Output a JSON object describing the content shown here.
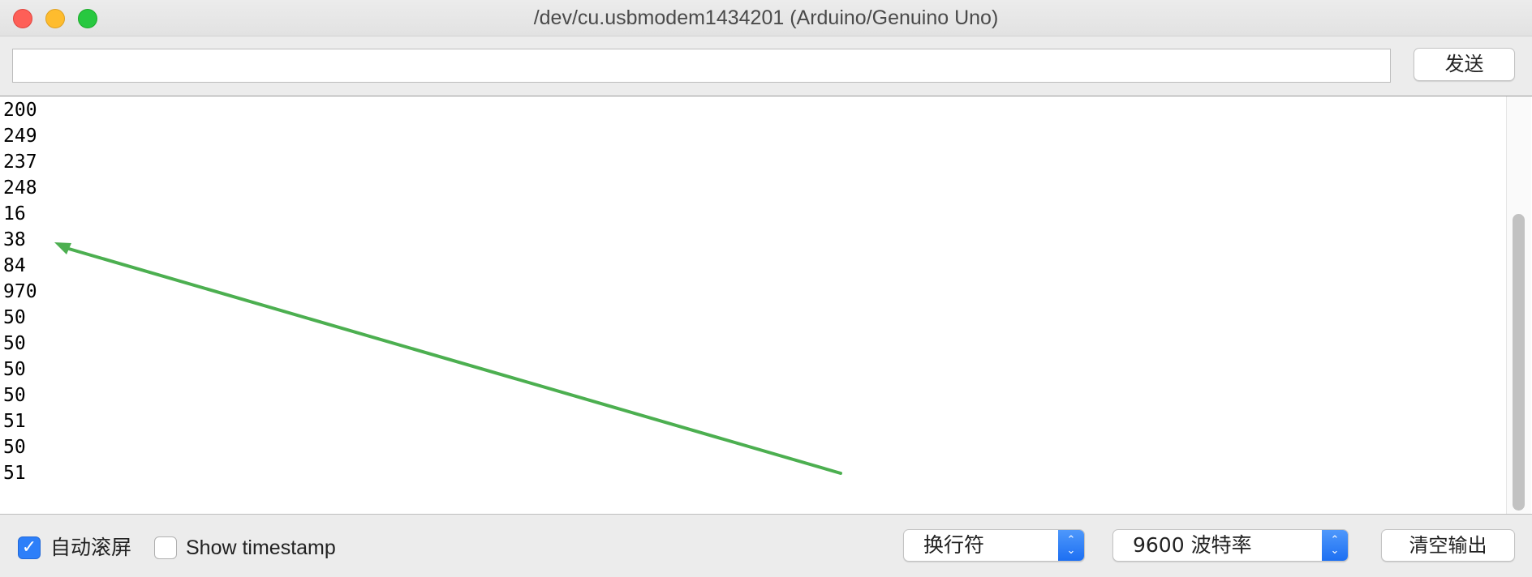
{
  "window": {
    "title": "/dev/cu.usbmodem1434201 (Arduino/Genuino Uno)"
  },
  "send": {
    "input_value": "",
    "button_label": "发送"
  },
  "output": {
    "lines": [
      "200",
      "249",
      "237",
      "248",
      "16",
      "38",
      "84",
      "970",
      "50",
      "50",
      "50",
      "50",
      "51",
      "50",
      "51"
    ]
  },
  "annotation": {
    "color": "#4caf50",
    "icon": "arrow-icon"
  },
  "footer": {
    "autoscroll": {
      "label": "自动滚屏",
      "checked": true
    },
    "timestamp": {
      "label": "Show timestamp",
      "checked": false
    },
    "line_ending": {
      "selected": "换行符"
    },
    "baud_rate": {
      "selected": "9600 波特率"
    },
    "clear_label": "清空输出"
  },
  "colors": {
    "accent": "#2d7ff9",
    "close": "#fe5f57",
    "minimize": "#febc2e",
    "maximize": "#28c840"
  }
}
